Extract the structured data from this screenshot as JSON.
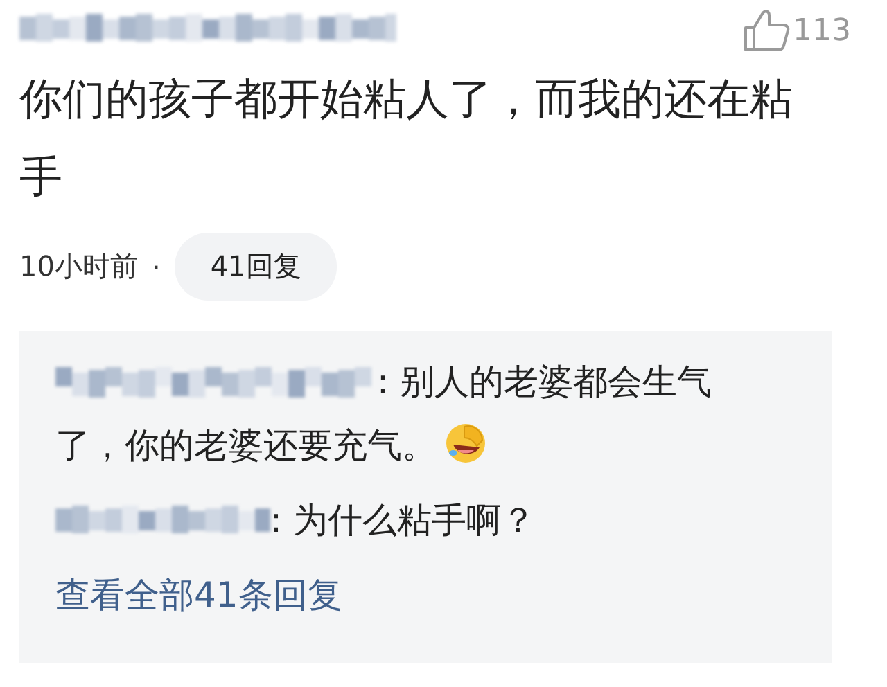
{
  "comment": {
    "likes": "113",
    "text": "你们的孩子都开始粘人了，而我的还在粘手",
    "time": "10小时前",
    "separator": "·",
    "reply_count_button": "41回复"
  },
  "replies": [
    {
      "text": ": 别人的老婆都会生气了，你的老婆还要充气。",
      "emoji": true
    },
    {
      "text": ": 为什么粘手啊？",
      "emoji": false
    }
  ],
  "view_all_link": "查看全部41条回复"
}
